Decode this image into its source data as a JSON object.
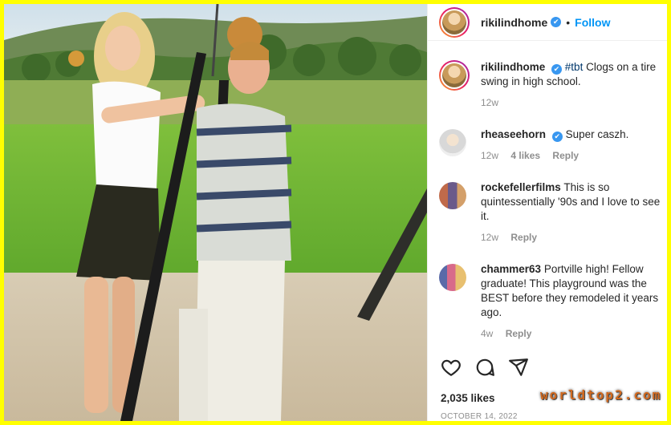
{
  "post": {
    "username": "rikilindhome",
    "follow_label": "Follow",
    "caption_hashtag": "#tbt",
    "caption_text": "Clogs on a tire swing in high school.",
    "caption_time": "12w",
    "likes_label": "2,035 likes",
    "date_label": "OCTOBER 14, 2022"
  },
  "comments": [
    {
      "user": "rheaseehorn",
      "verified": true,
      "text": "Super caszh.",
      "time": "12w",
      "likes": "4 likes",
      "reply": "Reply"
    },
    {
      "user": "rockefellerfilms",
      "verified": false,
      "text": "This is so quintessentially '90s and I love to see it.",
      "time": "12w",
      "likes": "",
      "reply": "Reply"
    },
    {
      "user": "chammer63",
      "verified": false,
      "text": "Portville high! Fellow graduate! This playground was the BEST before they remodeled it years ago.",
      "time": "4w",
      "likes": "",
      "reply": "Reply"
    }
  ],
  "icons": {
    "verified": "✔"
  },
  "watermark": "worldtop2.com",
  "colors": {
    "frame": "#ffff00",
    "link": "#0095f6",
    "verified": "#3897f0"
  }
}
